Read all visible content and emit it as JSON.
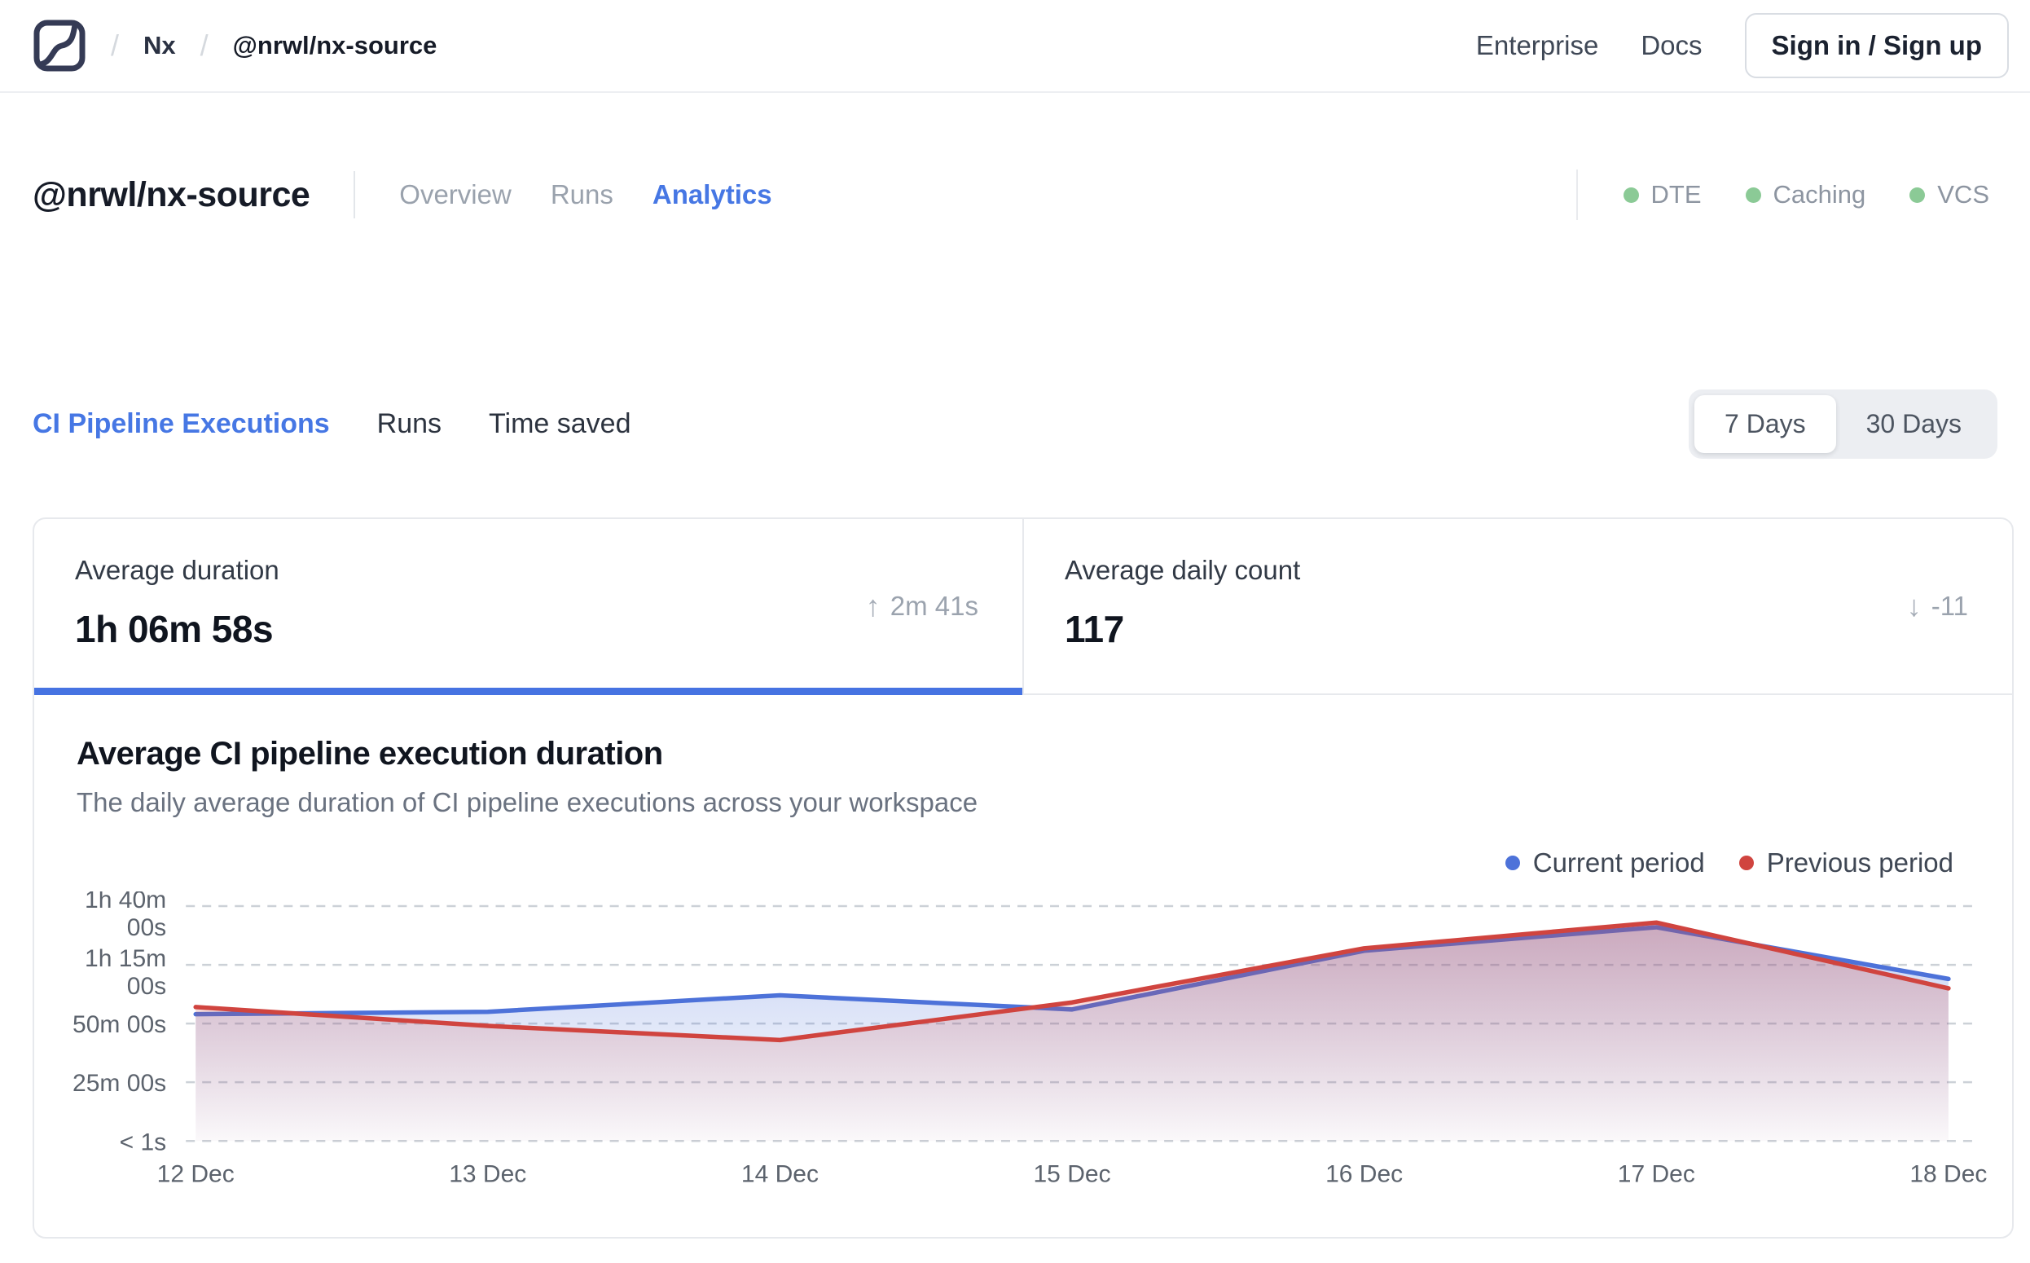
{
  "nav": {
    "breadcrumb": {
      "separator": "/",
      "org": "Nx",
      "repo": "@nrwl/nx-source"
    },
    "links": {
      "enterprise": "Enterprise",
      "docs": "Docs"
    },
    "signin_label": "Sign in / Sign up"
  },
  "workspace": {
    "title": "@nrwl/nx-source",
    "tabs": [
      {
        "label": "Overview",
        "active": false
      },
      {
        "label": "Runs",
        "active": false
      },
      {
        "label": "Analytics",
        "active": true
      }
    ],
    "features": [
      {
        "label": "DTE",
        "status_color": "#8bca96"
      },
      {
        "label": "Caching",
        "status_color": "#8bca96"
      },
      {
        "label": "VCS",
        "status_color": "#8bca96"
      }
    ]
  },
  "analytics": {
    "tabs": [
      {
        "label": "CI Pipeline Executions",
        "active": true
      },
      {
        "label": "Runs",
        "active": false
      },
      {
        "label": "Time saved",
        "active": false
      }
    ],
    "range_toggle": [
      {
        "label": "7 Days",
        "selected": true
      },
      {
        "label": "30 Days",
        "selected": false
      }
    ],
    "stats": [
      {
        "label": "Average duration",
        "value": "1h 06m 58s",
        "delta": "2m 41s",
        "delta_direction": "up",
        "active": true
      },
      {
        "label": "Average daily count",
        "value": "117",
        "delta": "-11",
        "delta_direction": "down",
        "active": false
      }
    ]
  },
  "icons": {
    "up_arrow": "↑",
    "down_arrow": "↓"
  },
  "colors": {
    "accent_blue": "#4677e4",
    "current_period": "#4d72d9",
    "previous_period": "#d0443f",
    "status_green": "#8bca96",
    "gridline": "#ccd1d7"
  },
  "chart_data": {
    "type": "line",
    "title": "Average CI pipeline execution duration",
    "subtitle": "The daily average duration of CI pipeline executions across your workspace",
    "categories": [
      "12 Dec",
      "13 Dec",
      "14 Dec",
      "15 Dec",
      "16 Dec",
      "17 Dec",
      "18 Dec"
    ],
    "unit": "minutes",
    "series": [
      {
        "name": "Current period",
        "color": "#4d72d9",
        "values": [
          54,
          55,
          62,
          56,
          81,
          91,
          69
        ]
      },
      {
        "name": "Previous period",
        "color": "#d0443f",
        "values": [
          57,
          49,
          43,
          59,
          82,
          93,
          65
        ]
      }
    ],
    "ylim": [
      0,
      100
    ],
    "yticks": [
      {
        "value": 100,
        "label": [
          "1h 40m",
          "00s"
        ]
      },
      {
        "value": 75,
        "label": [
          "1h 15m",
          "00s"
        ]
      },
      {
        "value": 50,
        "label": [
          "50m 00s"
        ]
      },
      {
        "value": 25,
        "label": [
          "25m 00s"
        ]
      },
      {
        "value": 0,
        "label": [
          "< 1s"
        ]
      }
    ],
    "grid": "dashed-horizontal",
    "legend_position": "top-right",
    "area_fill": true
  }
}
